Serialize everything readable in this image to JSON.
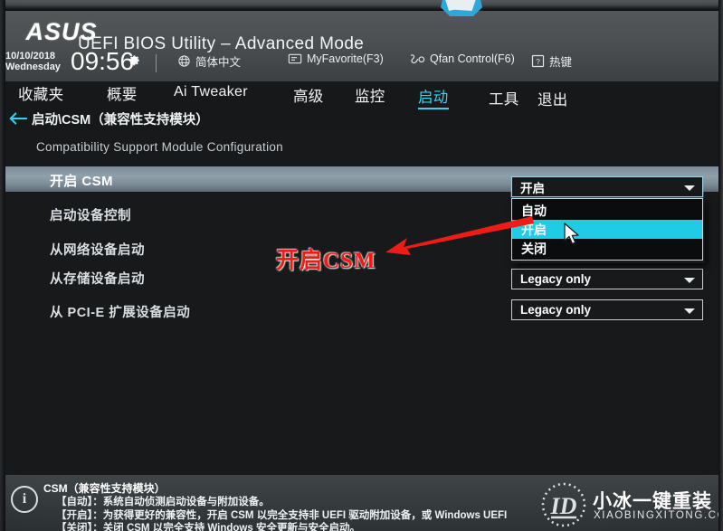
{
  "window": {
    "brand": "ASUS",
    "title": "UEFI BIOS Utility – Advanced Mode"
  },
  "header": {
    "date": "10/10/2018",
    "weekday": "Wednesday",
    "time": "09:56",
    "gear_icon": "gear-icon",
    "items": [
      {
        "icon": "globe-icon",
        "label": "简体中文"
      },
      {
        "icon": "myfavorite-icon",
        "label": "MyFavorite(F3)"
      },
      {
        "icon": "qfan-icon",
        "label": "Qfan Control(F6)"
      },
      {
        "icon": "question-icon",
        "label": "热键"
      }
    ]
  },
  "nav": {
    "tabs": [
      {
        "label": "收藏夹",
        "active": false
      },
      {
        "label": "概要",
        "active": false
      },
      {
        "label": "Ai Tweaker",
        "active": false
      },
      {
        "label": "高级",
        "active": false
      },
      {
        "label": "监控",
        "active": false
      },
      {
        "label": "启动",
        "active": true
      },
      {
        "label": "工具",
        "active": false
      },
      {
        "label": "退出",
        "active": false
      }
    ],
    "active_color": "#31d7f2"
  },
  "breadcrumb": {
    "back_icon": "back-arrow-icon",
    "path": "启动\\CSM（兼容性支持模块）"
  },
  "main": {
    "section_heading": "Compatibility Support Module Configuration",
    "rows": [
      {
        "label": "开启 CSM",
        "value": "开启",
        "highlighted": true
      },
      {
        "label": "启动设备控制",
        "value": "",
        "highlighted": false
      },
      {
        "label": "从网络设备启动",
        "value": "",
        "highlighted": false
      },
      {
        "label": "从存储设备启动",
        "value": "Legacy only",
        "highlighted": false
      },
      {
        "label": "从 PCI-E 扩展设备启动",
        "value": "Legacy only",
        "highlighted": false
      }
    ],
    "dropdown": {
      "open": true,
      "options": [
        {
          "label": "自动",
          "selected": false
        },
        {
          "label": "开启",
          "selected": true
        },
        {
          "label": "关闭",
          "selected": false
        }
      ],
      "highlight_color": "#20cbe8"
    }
  },
  "annotation": {
    "text": "开启CSM",
    "color": "#ee1c16",
    "arrow_icon": "red-arrow-icon"
  },
  "footer": {
    "info_icon": "info-icon",
    "title": "CSM（兼容性支持模块）",
    "lines": [
      "【自动】：系统自动侦测启动设备与附加设备。",
      "【开启】：为获得更好的兼容性，开启 CSM 以完全支持非 UEFI 驱动附加设备，或 Windows UEFI",
      "【关闭】：关闭 CSM 以完全支持 Windows 安全更新与安全启动。"
    ]
  },
  "watermark": {
    "cn": "小冰一键重装",
    "en": "XIAOBINGXITONG.COM"
  }
}
